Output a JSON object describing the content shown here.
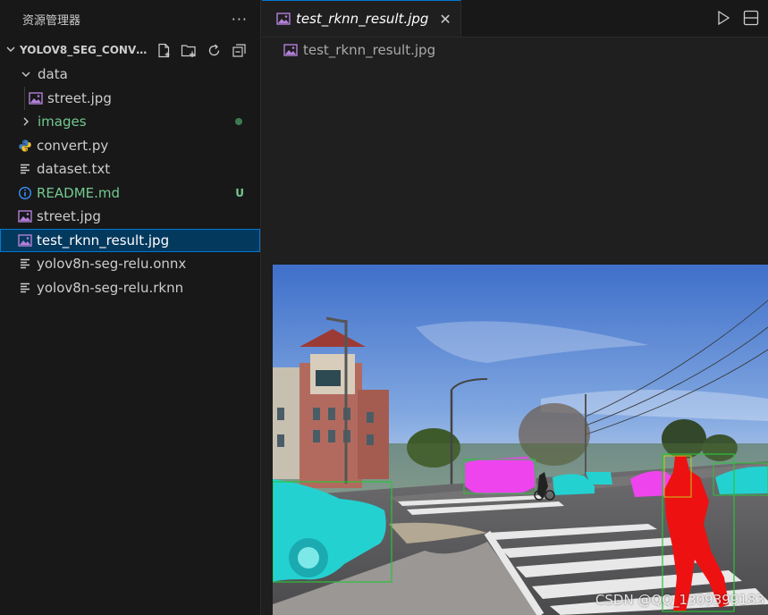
{
  "explorer": {
    "title": "资源管理器",
    "more": "···",
    "folder": "YOLOV8_SEG_CONVE...",
    "items": [
      {
        "label": "data",
        "kind": "folder-open"
      },
      {
        "label": "street.jpg",
        "kind": "image"
      },
      {
        "label": "images",
        "kind": "folder-closed",
        "status": "dot"
      },
      {
        "label": "convert.py",
        "kind": "python"
      },
      {
        "label": "dataset.txt",
        "kind": "text"
      },
      {
        "label": "README.md",
        "kind": "info",
        "badge": "U"
      },
      {
        "label": "street.jpg",
        "kind": "image"
      },
      {
        "label": "test_rknn_result.jpg",
        "kind": "image",
        "selected": true
      },
      {
        "label": "yolov8n-seg-relu.onnx",
        "kind": "text"
      },
      {
        "label": "yolov8n-seg-relu.rknn",
        "kind": "text"
      }
    ]
  },
  "editor": {
    "tab_label": "test_rknn_result.jpg",
    "tab_close": "✕",
    "breadcrumb": "test_rknn_result.jpg"
  },
  "image": {
    "watermark": "CSDN @QQ_1309399183"
  },
  "colors": {
    "accent": "#0078d4",
    "selection": "#04395e",
    "git_untracked": "#73c991",
    "image_icon": "#b180d7",
    "python_icon": "#3e7bbf",
    "info_icon": "#3794ff"
  },
  "icons": [
    "new-file-icon",
    "new-folder-icon",
    "refresh-icon",
    "collapse-all-icon",
    "run-icon",
    "split-editor-icon",
    "image-file-icon",
    "python-file-icon",
    "text-file-icon",
    "info-icon",
    "chevron-down-icon",
    "chevron-right-icon",
    "close-icon"
  ]
}
